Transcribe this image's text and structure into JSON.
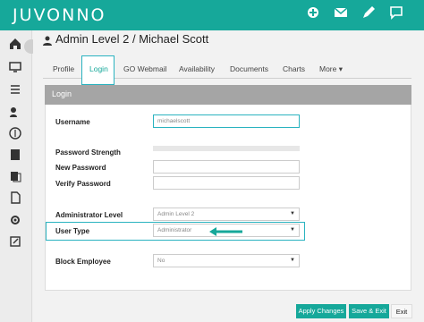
{
  "app": {
    "logo": "JUVONNO"
  },
  "header": {
    "title": "Admin Level 2 / Michael Scott"
  },
  "tabs": [
    {
      "label": "Profile"
    },
    {
      "label": "Login",
      "active": true
    },
    {
      "label": "GO Webmail"
    },
    {
      "label": "Availability"
    },
    {
      "label": "Documents"
    },
    {
      "label": "Charts"
    },
    {
      "label": "More ▾"
    }
  ],
  "panel": {
    "title": "Login"
  },
  "form": {
    "username_label": "Username",
    "username_value": "michaelscott",
    "password_strength_label": "Password Strength",
    "new_password_label": "New Password",
    "verify_password_label": "Verify Password",
    "admin_level_label": "Administrator Level",
    "admin_level_value": "Admin Level 2",
    "user_type_label": "User Type",
    "user_type_value": "Administrator",
    "block_employee_label": "Block Employee",
    "block_employee_value": "No"
  },
  "buttons": {
    "apply": "Apply Changes",
    "save_exit": "Save & Exit",
    "exit": "Exit"
  },
  "colors": {
    "accent": "#16a89a",
    "highlight": "#2ab3c0"
  }
}
